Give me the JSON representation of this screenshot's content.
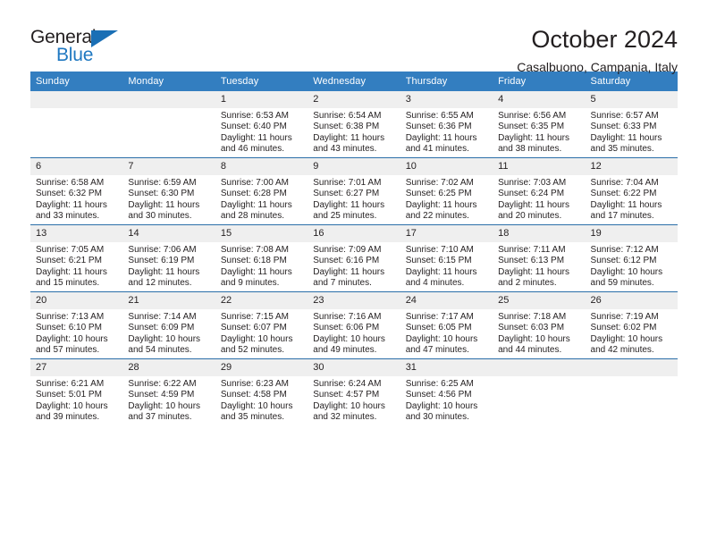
{
  "logo": {
    "word_general": "General",
    "word_blue": "Blue"
  },
  "header": {
    "title": "October 2024",
    "location": "Casalbuono, Campania, Italy"
  },
  "colors": {
    "header_blue": "#337ec0",
    "row_divider_blue": "#2a6ea8",
    "daynum_band": "#efefef",
    "logo_blue": "#1f78c1",
    "text": "#231f20"
  },
  "weekday_headers": [
    "Sunday",
    "Monday",
    "Tuesday",
    "Wednesday",
    "Thursday",
    "Friday",
    "Saturday"
  ],
  "weeks": [
    [
      {
        "day": "",
        "lines": []
      },
      {
        "day": "",
        "lines": []
      },
      {
        "day": "1",
        "lines": [
          "Sunrise: 6:53 AM",
          "Sunset: 6:40 PM",
          "Daylight: 11 hours",
          "and 46 minutes."
        ]
      },
      {
        "day": "2",
        "lines": [
          "Sunrise: 6:54 AM",
          "Sunset: 6:38 PM",
          "Daylight: 11 hours",
          "and 43 minutes."
        ]
      },
      {
        "day": "3",
        "lines": [
          "Sunrise: 6:55 AM",
          "Sunset: 6:36 PM",
          "Daylight: 11 hours",
          "and 41 minutes."
        ]
      },
      {
        "day": "4",
        "lines": [
          "Sunrise: 6:56 AM",
          "Sunset: 6:35 PM",
          "Daylight: 11 hours",
          "and 38 minutes."
        ]
      },
      {
        "day": "5",
        "lines": [
          "Sunrise: 6:57 AM",
          "Sunset: 6:33 PM",
          "Daylight: 11 hours",
          "and 35 minutes."
        ]
      }
    ],
    [
      {
        "day": "6",
        "lines": [
          "Sunrise: 6:58 AM",
          "Sunset: 6:32 PM",
          "Daylight: 11 hours",
          "and 33 minutes."
        ]
      },
      {
        "day": "7",
        "lines": [
          "Sunrise: 6:59 AM",
          "Sunset: 6:30 PM",
          "Daylight: 11 hours",
          "and 30 minutes."
        ]
      },
      {
        "day": "8",
        "lines": [
          "Sunrise: 7:00 AM",
          "Sunset: 6:28 PM",
          "Daylight: 11 hours",
          "and 28 minutes."
        ]
      },
      {
        "day": "9",
        "lines": [
          "Sunrise: 7:01 AM",
          "Sunset: 6:27 PM",
          "Daylight: 11 hours",
          "and 25 minutes."
        ]
      },
      {
        "day": "10",
        "lines": [
          "Sunrise: 7:02 AM",
          "Sunset: 6:25 PM",
          "Daylight: 11 hours",
          "and 22 minutes."
        ]
      },
      {
        "day": "11",
        "lines": [
          "Sunrise: 7:03 AM",
          "Sunset: 6:24 PM",
          "Daylight: 11 hours",
          "and 20 minutes."
        ]
      },
      {
        "day": "12",
        "lines": [
          "Sunrise: 7:04 AM",
          "Sunset: 6:22 PM",
          "Daylight: 11 hours",
          "and 17 minutes."
        ]
      }
    ],
    [
      {
        "day": "13",
        "lines": [
          "Sunrise: 7:05 AM",
          "Sunset: 6:21 PM",
          "Daylight: 11 hours",
          "and 15 minutes."
        ]
      },
      {
        "day": "14",
        "lines": [
          "Sunrise: 7:06 AM",
          "Sunset: 6:19 PM",
          "Daylight: 11 hours",
          "and 12 minutes."
        ]
      },
      {
        "day": "15",
        "lines": [
          "Sunrise: 7:08 AM",
          "Sunset: 6:18 PM",
          "Daylight: 11 hours",
          "and 9 minutes."
        ]
      },
      {
        "day": "16",
        "lines": [
          "Sunrise: 7:09 AM",
          "Sunset: 6:16 PM",
          "Daylight: 11 hours",
          "and 7 minutes."
        ]
      },
      {
        "day": "17",
        "lines": [
          "Sunrise: 7:10 AM",
          "Sunset: 6:15 PM",
          "Daylight: 11 hours",
          "and 4 minutes."
        ]
      },
      {
        "day": "18",
        "lines": [
          "Sunrise: 7:11 AM",
          "Sunset: 6:13 PM",
          "Daylight: 11 hours",
          "and 2 minutes."
        ]
      },
      {
        "day": "19",
        "lines": [
          "Sunrise: 7:12 AM",
          "Sunset: 6:12 PM",
          "Daylight: 10 hours",
          "and 59 minutes."
        ]
      }
    ],
    [
      {
        "day": "20",
        "lines": [
          "Sunrise: 7:13 AM",
          "Sunset: 6:10 PM",
          "Daylight: 10 hours",
          "and 57 minutes."
        ]
      },
      {
        "day": "21",
        "lines": [
          "Sunrise: 7:14 AM",
          "Sunset: 6:09 PM",
          "Daylight: 10 hours",
          "and 54 minutes."
        ]
      },
      {
        "day": "22",
        "lines": [
          "Sunrise: 7:15 AM",
          "Sunset: 6:07 PM",
          "Daylight: 10 hours",
          "and 52 minutes."
        ]
      },
      {
        "day": "23",
        "lines": [
          "Sunrise: 7:16 AM",
          "Sunset: 6:06 PM",
          "Daylight: 10 hours",
          "and 49 minutes."
        ]
      },
      {
        "day": "24",
        "lines": [
          "Sunrise: 7:17 AM",
          "Sunset: 6:05 PM",
          "Daylight: 10 hours",
          "and 47 minutes."
        ]
      },
      {
        "day": "25",
        "lines": [
          "Sunrise: 7:18 AM",
          "Sunset: 6:03 PM",
          "Daylight: 10 hours",
          "and 44 minutes."
        ]
      },
      {
        "day": "26",
        "lines": [
          "Sunrise: 7:19 AM",
          "Sunset: 6:02 PM",
          "Daylight: 10 hours",
          "and 42 minutes."
        ]
      }
    ],
    [
      {
        "day": "27",
        "lines": [
          "Sunrise: 6:21 AM",
          "Sunset: 5:01 PM",
          "Daylight: 10 hours",
          "and 39 minutes."
        ]
      },
      {
        "day": "28",
        "lines": [
          "Sunrise: 6:22 AM",
          "Sunset: 4:59 PM",
          "Daylight: 10 hours",
          "and 37 minutes."
        ]
      },
      {
        "day": "29",
        "lines": [
          "Sunrise: 6:23 AM",
          "Sunset: 4:58 PM",
          "Daylight: 10 hours",
          "and 35 minutes."
        ]
      },
      {
        "day": "30",
        "lines": [
          "Sunrise: 6:24 AM",
          "Sunset: 4:57 PM",
          "Daylight: 10 hours",
          "and 32 minutes."
        ]
      },
      {
        "day": "31",
        "lines": [
          "Sunrise: 6:25 AM",
          "Sunset: 4:56 PM",
          "Daylight: 10 hours",
          "and 30 minutes."
        ]
      },
      {
        "day": "",
        "lines": []
      },
      {
        "day": "",
        "lines": []
      }
    ]
  ]
}
